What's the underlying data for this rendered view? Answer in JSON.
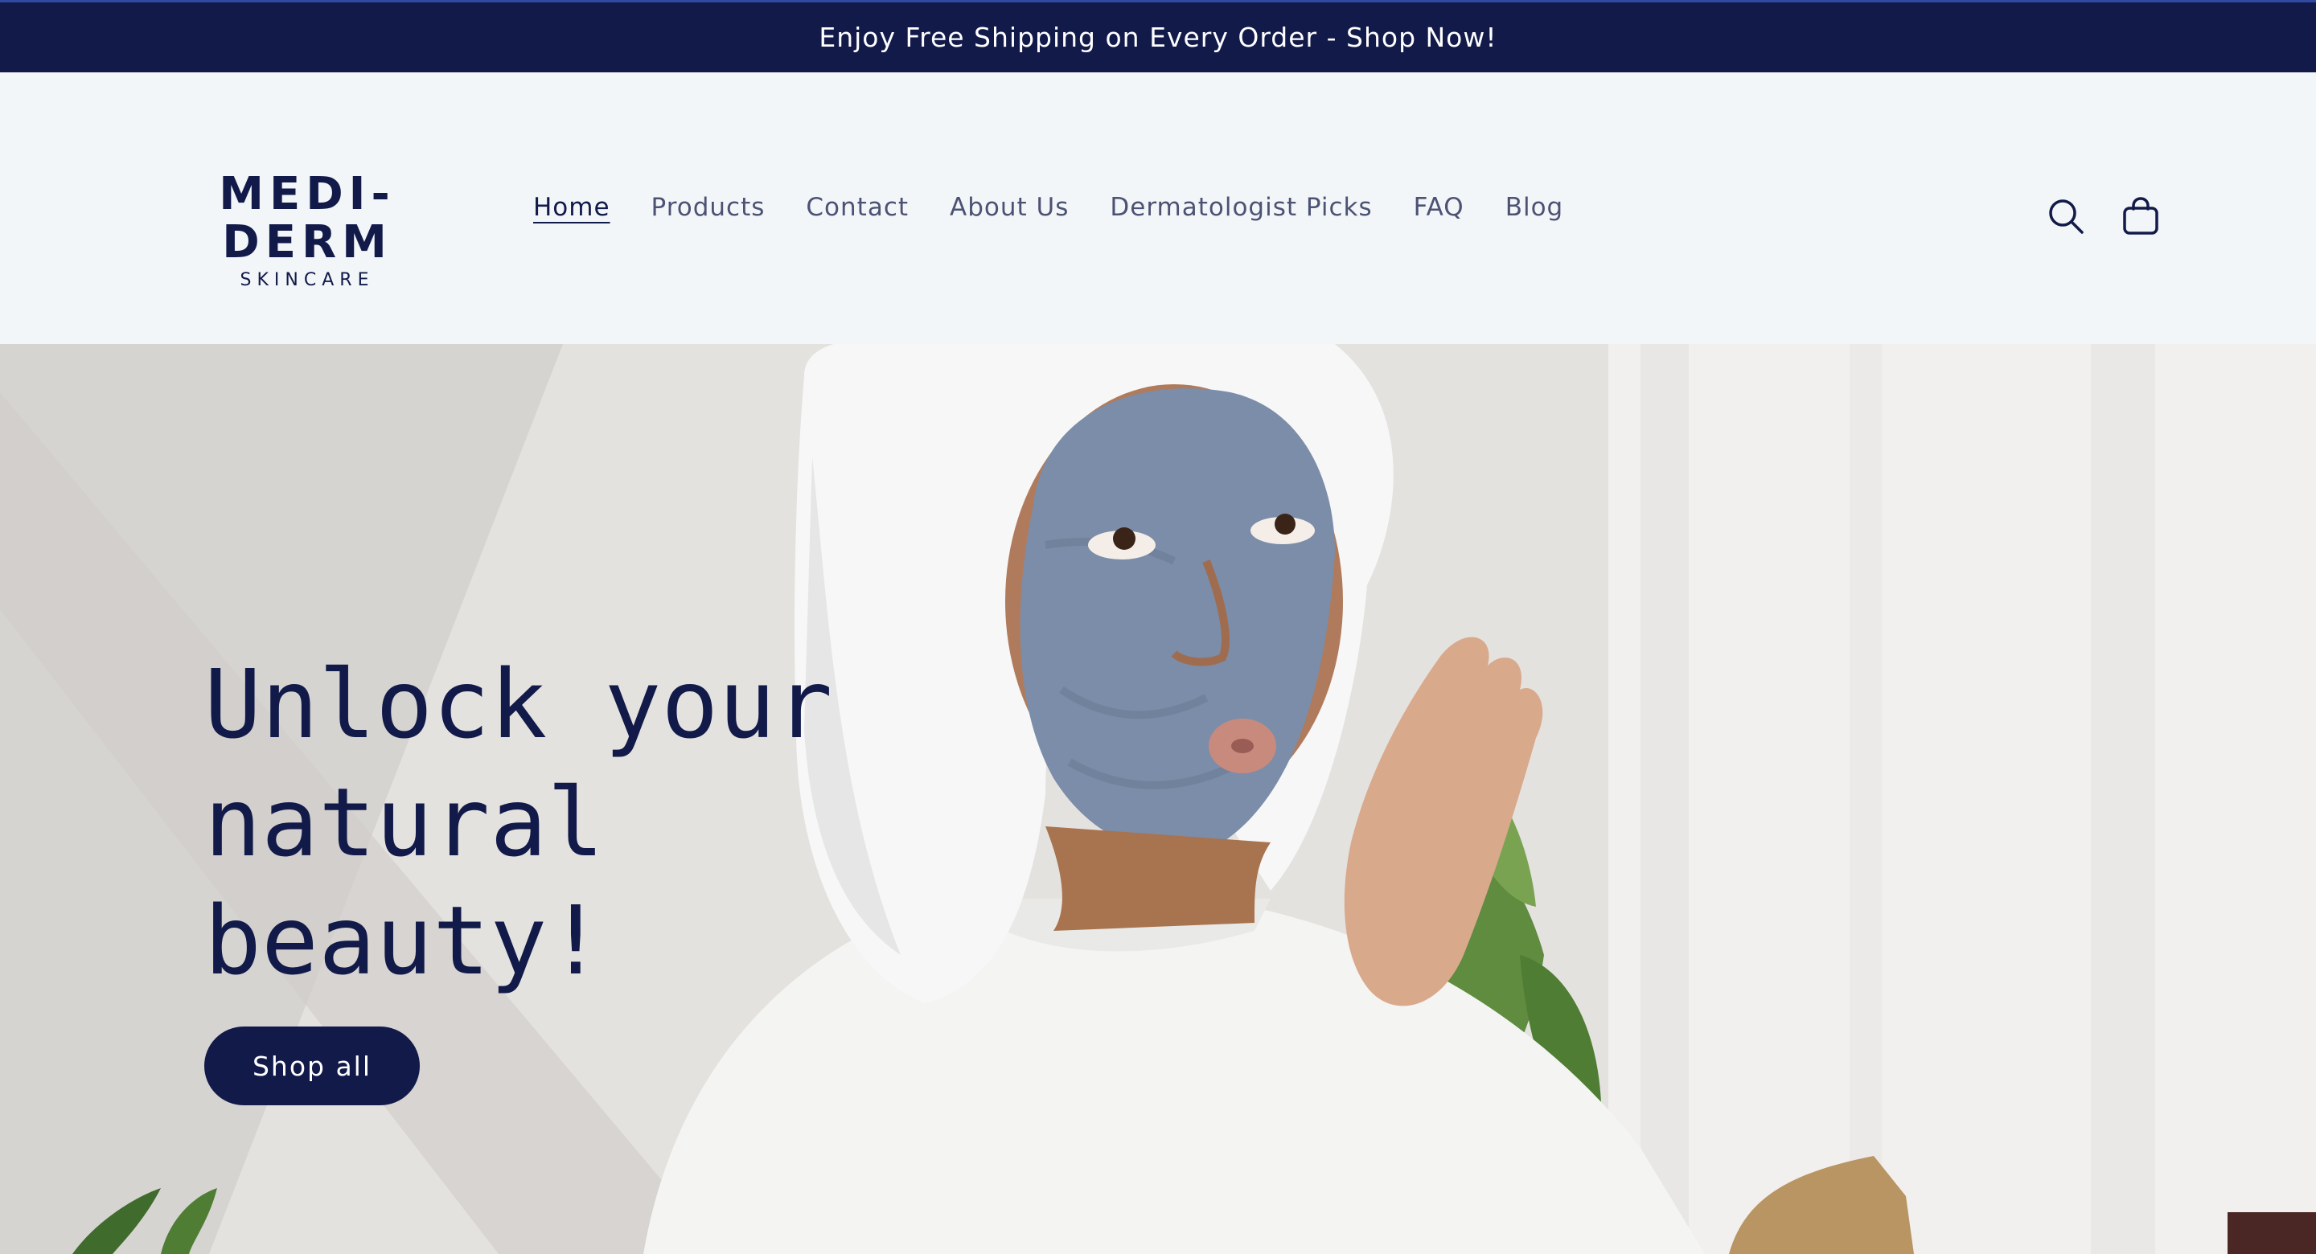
{
  "announcement": {
    "text": "Enjoy Free Shipping on Every Order - Shop Now!"
  },
  "header": {
    "logo": {
      "main": "MEDI-DERM",
      "sub": "SKINCARE"
    },
    "nav": [
      {
        "label": "Home",
        "active": true
      },
      {
        "label": "Products"
      },
      {
        "label": "Contact"
      },
      {
        "label": "About Us"
      },
      {
        "label": "Dermatologist Picks"
      },
      {
        "label": "FAQ"
      },
      {
        "label": "Blog"
      }
    ],
    "icons": {
      "search": "search-icon",
      "cart": "cart-icon"
    }
  },
  "hero": {
    "heading": "Unlock your\nnatural\nbeauty!",
    "button_label": "Shop all"
  },
  "colors": {
    "brand_navy": "#121a4a",
    "header_bg": "#f3f6f8",
    "nav_text": "#4c5274"
  }
}
